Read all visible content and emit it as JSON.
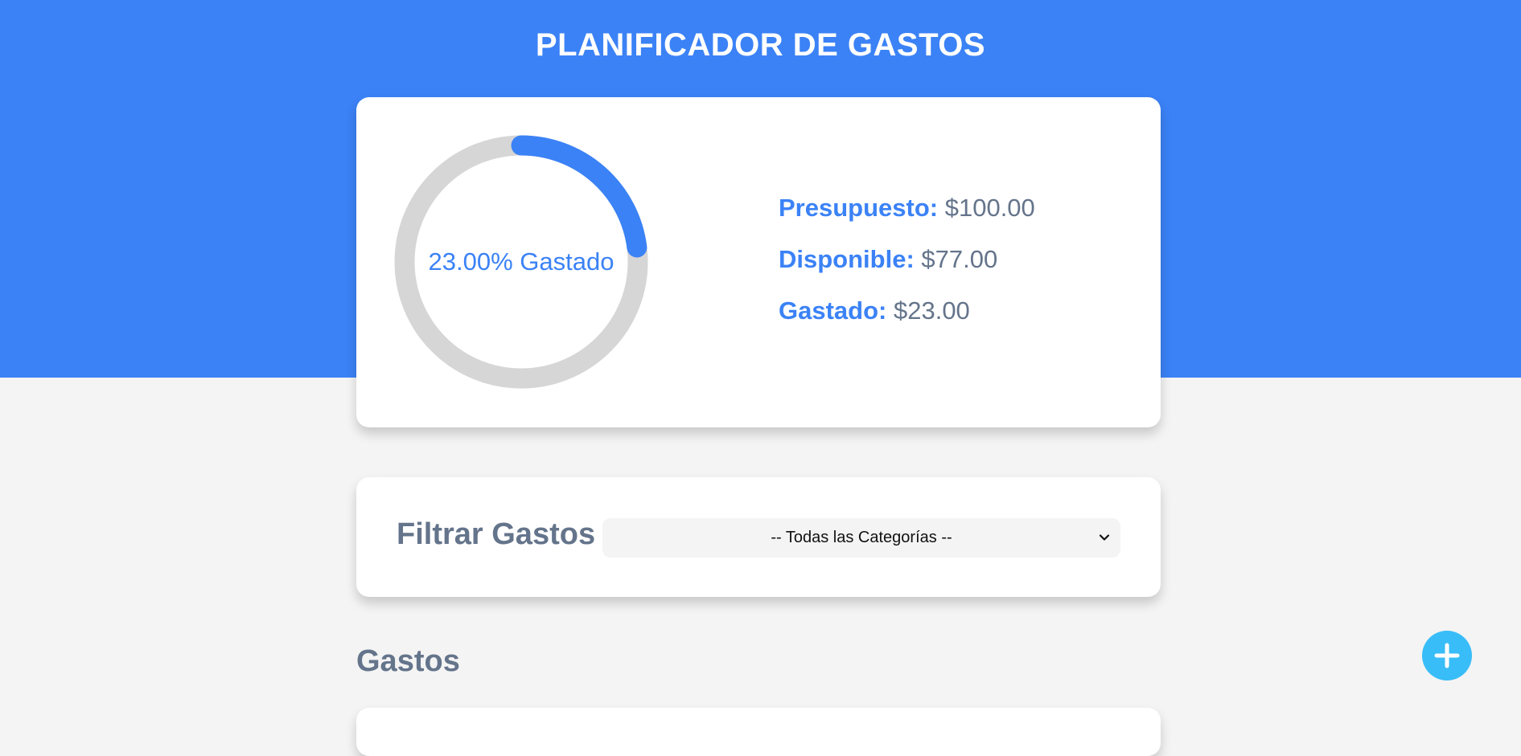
{
  "header": {
    "title": "PLANIFICADOR DE GASTOS",
    "background_color": "#3b82f6"
  },
  "budget": {
    "percent_spent": 23.0,
    "progress_label": "23.00% Gastado",
    "stats": [
      {
        "label": "Presupuesto:",
        "value": "$100.00"
      },
      {
        "label": "Disponible:",
        "value": "$77.00"
      },
      {
        "label": "Gastado:",
        "value": "$23.00"
      }
    ],
    "progress_color": "#3b82f6",
    "track_color": "#d6d6d6"
  },
  "filter": {
    "title": "Filtrar Gastos",
    "selected_option": "-- Todas las Categorías --"
  },
  "expenses": {
    "title": "Gastos"
  },
  "add_button": {
    "icon": "plus-icon",
    "color": "#38bdf8"
  }
}
